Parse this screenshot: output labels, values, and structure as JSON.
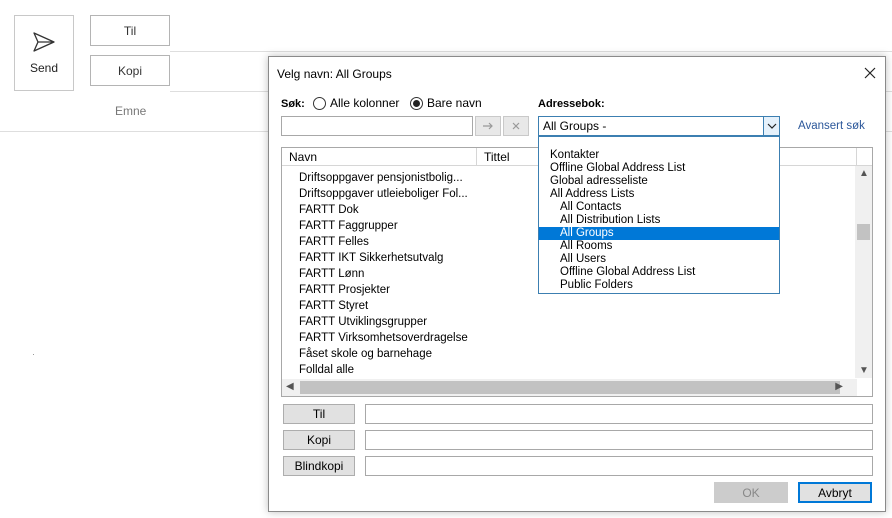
{
  "compose": {
    "send_label": "Send",
    "to_label": "Til",
    "cc_label": "Kopi",
    "subject_label": "Emne"
  },
  "dialog": {
    "title": "Velg navn: All Groups",
    "search_label": "Søk:",
    "radio_all_columns": "Alle kolonner",
    "radio_name_only": "Bare navn",
    "radio_selected": "Bare navn",
    "search_value": "",
    "addressbook_label": "Adressebok:",
    "addressbook_value": "All Groups -",
    "advanced_search": "Avansert søk",
    "columns": [
      "Navn",
      "Tittel"
    ],
    "rows": [
      "Driftsoppgaver pensjonistbolig...",
      "Driftsoppgaver utleieboliger Fol...",
      "FARTT Dok",
      "FARTT Faggrupper",
      "FARTT Felles",
      "FARTT IKT Sikkerhetsutvalg",
      "FARTT Lønn",
      "FARTT Prosjekter",
      "FARTT Styret",
      "FARTT Utviklingsgrupper",
      "FARTT Virksomhetsoverdragelse",
      "Fåset skole og barnehage",
      "Folldal alle"
    ],
    "dropdown_items": [
      {
        "label": "Kontakter",
        "indent": 1
      },
      {
        "label": "Offline Global Address List",
        "indent": 1
      },
      {
        "label": "Global adresseliste",
        "indent": 1
      },
      {
        "label": "All Address Lists",
        "indent": 1
      },
      {
        "label": "All Contacts",
        "indent": 2
      },
      {
        "label": "All Distribution Lists",
        "indent": 2
      },
      {
        "label": "All Groups",
        "indent": 2
      },
      {
        "label": "All Rooms",
        "indent": 2
      },
      {
        "label": "All Users",
        "indent": 2
      },
      {
        "label": "Offline Global Address List",
        "indent": 2
      },
      {
        "label": "Public Folders",
        "indent": 2
      }
    ],
    "dropdown_selected": "All Groups",
    "to_button": "Til",
    "cc_button": "Kopi",
    "bcc_button": "Blindkopi",
    "to_value": "",
    "cc_value": "",
    "bcc_value": "",
    "ok_label": "OK",
    "cancel_label": "Avbryt",
    "ok_enabled": false
  },
  "colors": {
    "accent": "#0078d7",
    "link": "#2b579a",
    "focus_border": "#3c7fb1"
  },
  "icons": {
    "send": "paper-plane-icon",
    "close": "close-icon",
    "go_arrow": "arrow-right-icon",
    "clear": "x-icon",
    "dropdown": "chevron-down-icon",
    "scroll_up": "scroll-up-icon",
    "scroll_down": "scroll-down-icon",
    "scroll_left": "scroll-left-icon",
    "scroll_right": "scroll-right-icon"
  }
}
